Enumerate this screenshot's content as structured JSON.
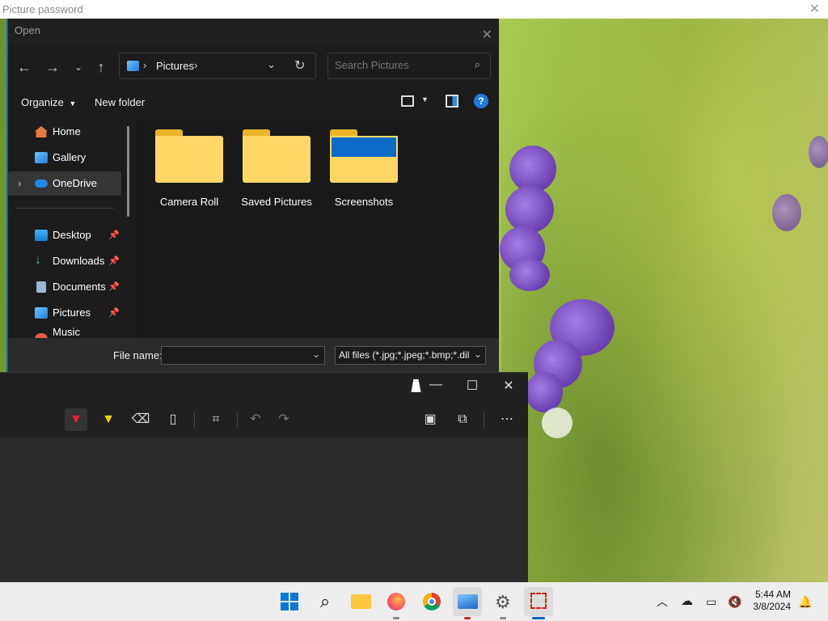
{
  "picture_password": {
    "title": "Picture password"
  },
  "open_dialog": {
    "title": "Open",
    "address": {
      "location": "Pictures"
    },
    "search": {
      "placeholder": "Search Pictures"
    },
    "toolbar": {
      "organize": "Organize",
      "new_folder": "New folder"
    },
    "sidebar": [
      {
        "label": "Home",
        "icon": "home-icon",
        "pinned": false
      },
      {
        "label": "Gallery",
        "icon": "gallery-icon",
        "pinned": false
      },
      {
        "label": "OneDrive",
        "icon": "onedrive-icon",
        "pinned": false,
        "selected": true
      },
      {
        "label": "Desktop",
        "icon": "desktop-icon",
        "pinned": true
      },
      {
        "label": "Downloads",
        "icon": "downloads-icon",
        "pinned": true
      },
      {
        "label": "Documents",
        "icon": "documents-icon",
        "pinned": true
      },
      {
        "label": "Pictures",
        "icon": "pictures-icon",
        "pinned": true
      },
      {
        "label": "Music",
        "icon": "music-icon",
        "pinned": true
      }
    ],
    "folders": [
      {
        "name": "Camera Roll"
      },
      {
        "name": "Saved Pictures"
      },
      {
        "name": "Screenshots"
      }
    ],
    "footer": {
      "file_name_label": "File name:",
      "file_name_value": "",
      "file_type": "All files (*.jpg;*.jpeg;*.bmp;*.dil"
    }
  },
  "snipping_tool": {
    "tools": [
      "pen-icon",
      "highlighter-icon",
      "eraser-icon",
      "ruler-icon",
      "crop-icon",
      "undo-icon",
      "redo-icon",
      "save-icon",
      "copy-icon",
      "more-icon"
    ]
  },
  "taskbar": {
    "clock_time": "5:44 AM",
    "clock_date": "3/8/2024"
  },
  "colors": {
    "accent": "#0067c0",
    "folder_yellow": "#ffd765",
    "dialog_bg": "#1c1c1c",
    "taskbar_bg": "#ededed"
  }
}
